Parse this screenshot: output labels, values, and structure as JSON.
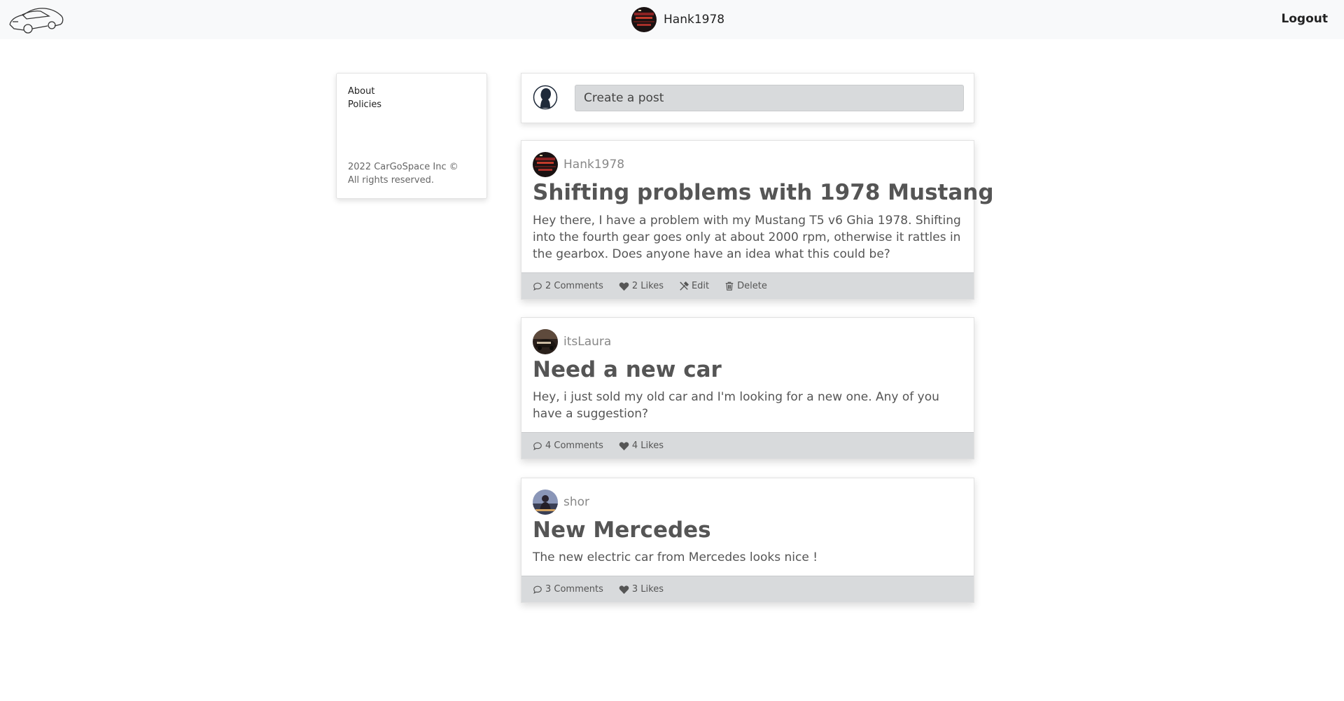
{
  "header": {
    "username": "Hank1978",
    "logout_label": "Logout"
  },
  "sidebar": {
    "links": [
      "About",
      "Policies"
    ],
    "copyright_line1": "2022 CarGoSpace Inc ©",
    "copyright_line2": "All rights reserved."
  },
  "composer": {
    "placeholder": "Create a post"
  },
  "posts": [
    {
      "author": "Hank1978",
      "title": "Shifting problems with 1978 Mustang",
      "body": "Hey there, I have a problem with my Mustang T5 v6 Ghia 1978. Shifting into the fourth gear goes only at about 2000 rpm, otherwise it rattles in the gearbox. Does anyone have an idea what this could be?",
      "comments": "2 Comments",
      "likes": "2 Likes",
      "edit": "Edit",
      "delete": "Delete"
    },
    {
      "author": "itsLaura",
      "title": "Need a new car",
      "body": "Hey, i just sold my old car and I'm looking for a new one. Any of you have a suggestion?",
      "comments": "4 Comments",
      "likes": "4 Likes"
    },
    {
      "author": "shor",
      "title": "New Mercedes",
      "body": "The new electric car from Mercedes looks nice !",
      "comments": "3 Comments",
      "likes": "3 Likes"
    }
  ],
  "icons": {
    "logo": "car-outline-logo",
    "comment": "speech-bubble-icon",
    "like": "heart-icon",
    "edit": "tools-icon",
    "delete": "trash-icon",
    "default_avatar": "person-silhouette-icon"
  },
  "colors": {
    "header_bg": "#f8f9fa",
    "footer_bg": "#d8dadc",
    "title_text": "#555555",
    "author_text": "#888888"
  }
}
